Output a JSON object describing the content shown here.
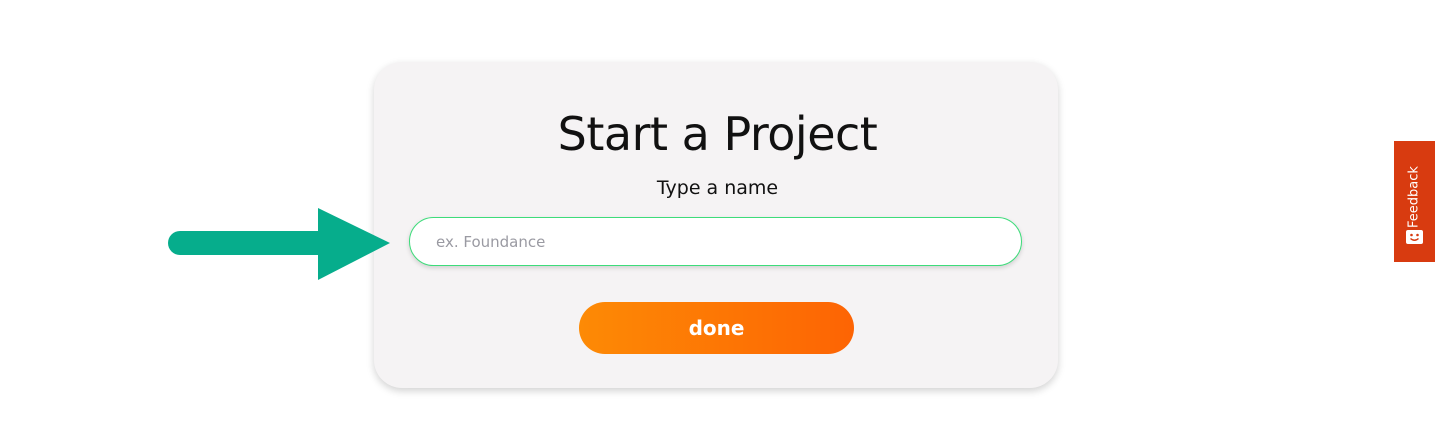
{
  "card": {
    "title": "Start a Project",
    "subtitle": "Type a name"
  },
  "name_input": {
    "placeholder": "ex. Foundance",
    "value": ""
  },
  "done_button": {
    "label": "done"
  },
  "feedback": {
    "label": "Feedback",
    "icon": "smiley-icon"
  },
  "annotation": {
    "icon": "right-arrow-icon",
    "color": "#06ad8c"
  },
  "colors": {
    "accent_start": "#fd8a05",
    "accent_end": "#fd6404",
    "input_border": "#3ddc7a",
    "feedback_bg": "#d83b10",
    "card_bg": "#f5f3f4"
  }
}
